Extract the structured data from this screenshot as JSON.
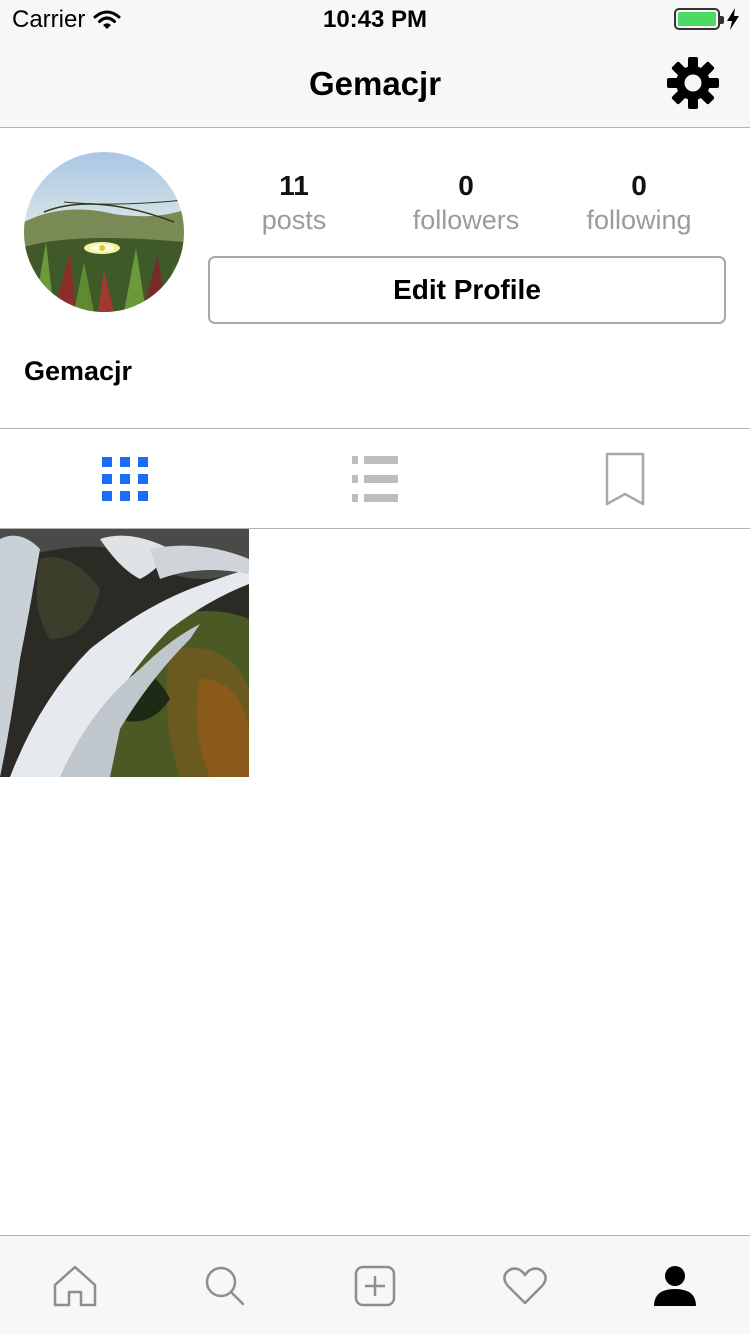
{
  "status_bar": {
    "carrier": "Carrier",
    "time": "10:43 PM",
    "battery_level": 1.0,
    "battery_color": "#4cd964"
  },
  "nav": {
    "title": "Gemacjr",
    "settings_icon": "gear-icon"
  },
  "profile": {
    "stats": [
      {
        "value": "11",
        "label": "posts"
      },
      {
        "value": "0",
        "label": "followers"
      },
      {
        "value": "0",
        "label": "following"
      }
    ],
    "edit_button_label": "Edit Profile",
    "display_name": "Gemacjr"
  },
  "view_tabs": [
    {
      "icon": "grid-icon",
      "active": true
    },
    {
      "icon": "list-icon",
      "active": false
    },
    {
      "icon": "bookmark-icon",
      "active": false
    }
  ],
  "accent_color": "#1a6df5",
  "bottom_tabs": [
    {
      "icon": "home-icon"
    },
    {
      "icon": "search-icon"
    },
    {
      "icon": "add-post-icon"
    },
    {
      "icon": "heart-icon"
    },
    {
      "icon": "profile-icon",
      "active": true
    }
  ]
}
